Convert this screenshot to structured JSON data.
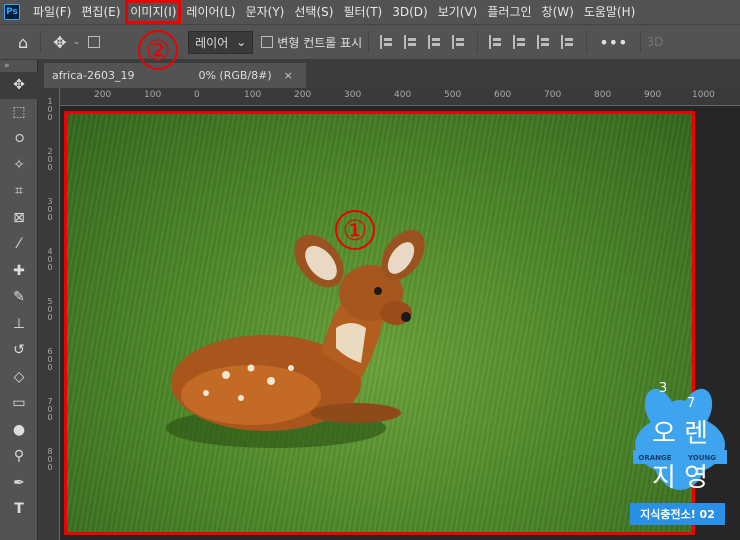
{
  "app": {
    "logo": "Ps"
  },
  "menu": {
    "items": [
      "파일(F)",
      "편집(E)",
      "이미지(I)",
      "레이어(L)",
      "문자(Y)",
      "선택(S)",
      "필터(T)",
      "3D(D)",
      "보기(V)",
      "플러그인",
      "창(W)",
      "도움말(H)"
    ],
    "highlighted": "이미지(I)"
  },
  "options": {
    "layer_dropdown": "레이어",
    "transform_label": "변형 컨트롤 표시",
    "mode_3d": "3D",
    "more": "•••"
  },
  "tab": {
    "title": "africa-2603_19",
    "suffix": "0% (RGB/8#)",
    "close": "×",
    "panel_toggle": "»"
  },
  "ruler": {
    "top_labels": [
      "200",
      "100",
      "0",
      "100",
      "200",
      "300",
      "400",
      "500",
      "600",
      "700",
      "800",
      "900",
      "1000"
    ],
    "left_labels": [
      "1 0 0",
      "2 0 0",
      "3 0 0",
      "4 0 0",
      "5 0 0",
      "6 0 0",
      "7 0 0",
      "8 0 0"
    ]
  },
  "annotations": {
    "one": "①",
    "two": "②"
  },
  "watermark": {
    "numbers_top_left": "3",
    "numbers_top_right": "7",
    "line1": "오 렌",
    "orange": "ORANGE",
    "young": "YOUNG",
    "line2": "지 영",
    "bar": "지식충전소! 02"
  },
  "colors": {
    "highlight": "#ee0000",
    "ui_bg": "#535353",
    "accent": "#31a8ff",
    "watermark_blue": "#2a8fe6"
  }
}
